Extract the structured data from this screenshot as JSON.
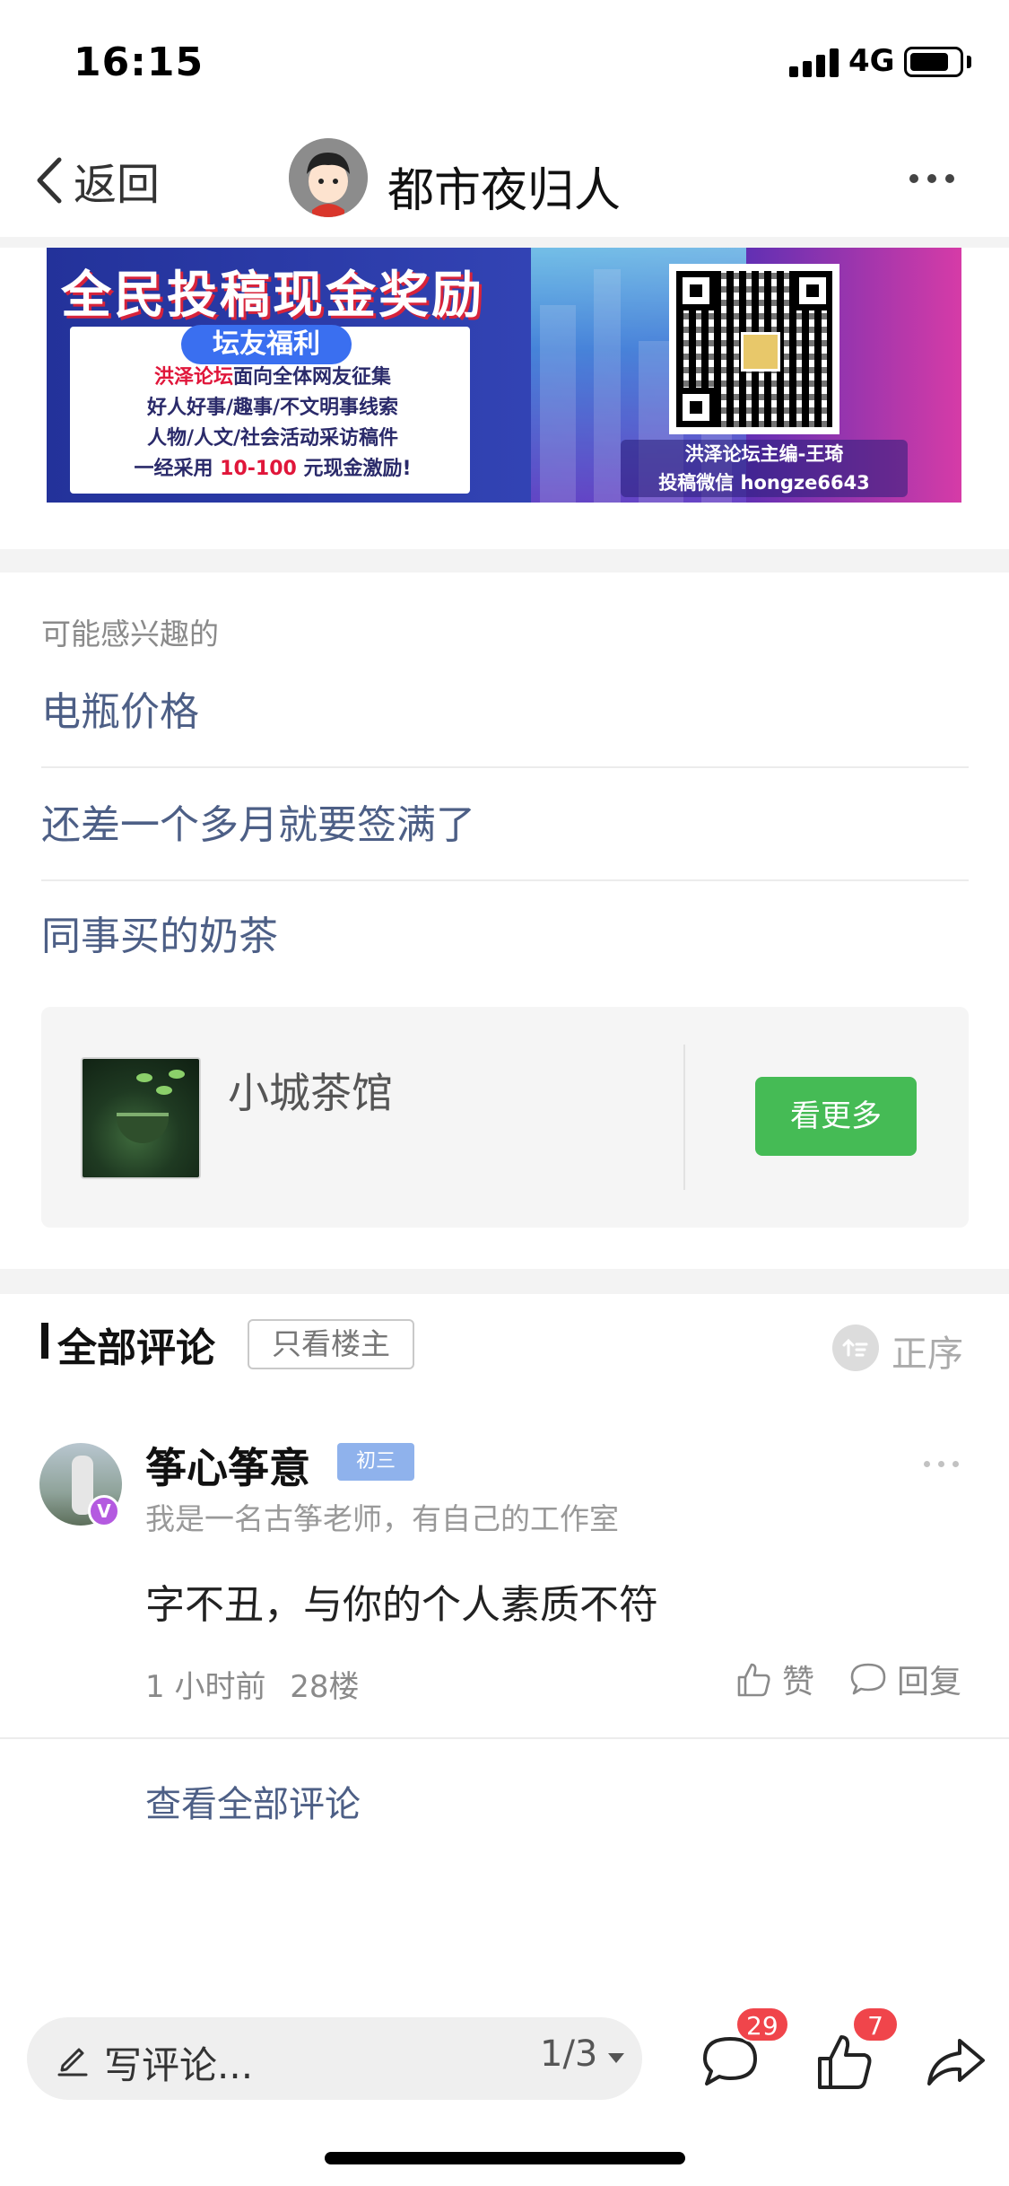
{
  "status_bar": {
    "time": "16:15",
    "network": "4G"
  },
  "nav": {
    "back_label": "返回",
    "title": "都市夜归人"
  },
  "banner": {
    "headline": "全民投稿现金奖励",
    "tag": "坛友福利",
    "line1_highlight": "洪泽论坛",
    "line1_rest": "面向全体网友征集",
    "line2": "好人好事/趣事/不文明事线索",
    "line3": "人物/人文/社会活动采访稿件",
    "line4_prefix": "一经采用",
    "line4_amount": "10-100",
    "line4_suffix": "元现金激励!",
    "qr_caption_1": "洪泽论坛主编-王琦",
    "qr_caption_2": "投稿微信 hongze6643"
  },
  "interests": {
    "heading": "可能感兴趣的",
    "items": [
      "电瓶价格",
      "还差一个多月就要签满了",
      "同事买的奶茶"
    ]
  },
  "forum_card": {
    "name": "小城茶馆",
    "button": "看更多"
  },
  "comments_header": {
    "title": "全部评论",
    "op_only": "只看楼主",
    "order": "正序"
  },
  "comment": {
    "name": "筝心筝意",
    "level": "初三",
    "verified": "V",
    "bio": "我是一名古筝老师，有自己的工作室",
    "text": "字不丑，与你的个人素质不符",
    "time": "1 小时前",
    "floor": "28楼",
    "like_label": "赞",
    "reply_label": "回复"
  },
  "view_all": "查看全部评论",
  "bottom_bar": {
    "write_placeholder": "写评论...",
    "page_indicator": "1/3",
    "comment_count": "29",
    "like_count": "7"
  }
}
